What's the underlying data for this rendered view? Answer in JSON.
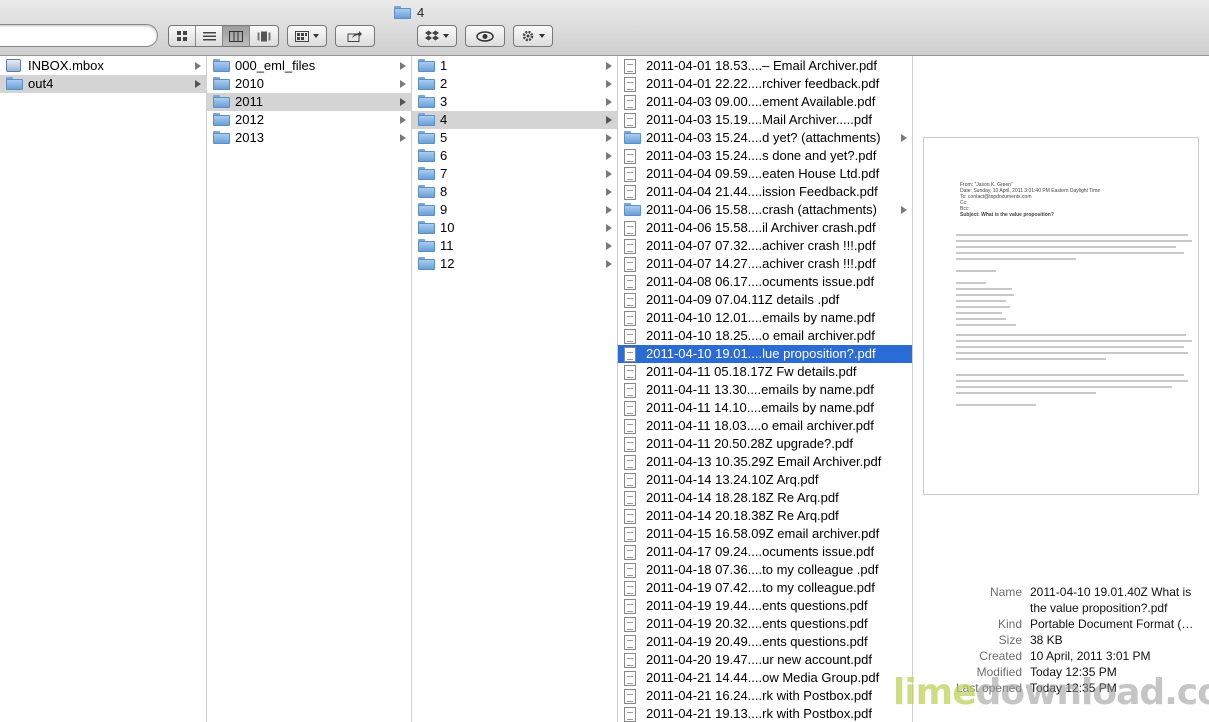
{
  "window": {
    "title": "4"
  },
  "toolbar": {
    "view_buttons": [
      "icon-view-icon",
      "list-view-icon",
      "column-view-icon",
      "coverflow-view-icon"
    ],
    "active_view": 2
  },
  "columns": {
    "col1": [
      {
        "label": "INBOX.mbox",
        "icon": "mbox",
        "arrow": true,
        "selected": false
      },
      {
        "label": "out4",
        "icon": "folder",
        "arrow": true,
        "selected": true
      }
    ],
    "col2": [
      {
        "label": "000_eml_files",
        "icon": "folder",
        "arrow": true,
        "selected": false
      },
      {
        "label": "2010",
        "icon": "folder",
        "arrow": true,
        "selected": false
      },
      {
        "label": "2011",
        "icon": "folder",
        "arrow": true,
        "selected": true
      },
      {
        "label": "2012",
        "icon": "folder",
        "arrow": true,
        "selected": false
      },
      {
        "label": "2013",
        "icon": "folder",
        "arrow": true,
        "selected": false
      }
    ],
    "col3": [
      {
        "label": "1",
        "icon": "folder",
        "arrow": true,
        "selected": false
      },
      {
        "label": "2",
        "icon": "folder",
        "arrow": true,
        "selected": false
      },
      {
        "label": "3",
        "icon": "folder",
        "arrow": true,
        "selected": false
      },
      {
        "label": "4",
        "icon": "folder",
        "arrow": true,
        "selected": true
      },
      {
        "label": "5",
        "icon": "folder",
        "arrow": true,
        "selected": false
      },
      {
        "label": "6",
        "icon": "folder",
        "arrow": true,
        "selected": false
      },
      {
        "label": "7",
        "icon": "folder",
        "arrow": true,
        "selected": false
      },
      {
        "label": "8",
        "icon": "folder",
        "arrow": true,
        "selected": false
      },
      {
        "label": "9",
        "icon": "folder",
        "arrow": true,
        "selected": false
      },
      {
        "label": "10",
        "icon": "folder",
        "arrow": true,
        "selected": false
      },
      {
        "label": "11",
        "icon": "folder",
        "arrow": true,
        "selected": false
      },
      {
        "label": "12",
        "icon": "folder",
        "arrow": true,
        "selected": false
      }
    ],
    "col4": [
      {
        "label": "2011-04-01 18.53....– Email Archiver.pdf",
        "icon": "pdf",
        "arrow": false,
        "selected": false
      },
      {
        "label": "2011-04-01 22.22....rchiver feedback.pdf",
        "icon": "pdf",
        "arrow": false,
        "selected": false
      },
      {
        "label": "2011-04-03 09.00....ement Available.pdf",
        "icon": "pdf",
        "arrow": false,
        "selected": false
      },
      {
        "label": "2011-04-03 15.19....Mail Archiver.....pdf",
        "icon": "pdf",
        "arrow": false,
        "selected": false
      },
      {
        "label": "2011-04-03 15.24....d yet? (attachments)",
        "icon": "folder",
        "arrow": true,
        "selected": false
      },
      {
        "label": "2011-04-03 15.24....s done and yet?.pdf",
        "icon": "pdf",
        "arrow": false,
        "selected": false
      },
      {
        "label": "2011-04-04 09.59....eaten House Ltd.pdf",
        "icon": "pdf",
        "arrow": false,
        "selected": false
      },
      {
        "label": "2011-04-04 21.44....ission Feedback.pdf",
        "icon": "pdf",
        "arrow": false,
        "selected": false
      },
      {
        "label": "2011-04-06 15.58....crash (attachments)",
        "icon": "folder",
        "arrow": true,
        "selected": false
      },
      {
        "label": "2011-04-06 15.58....il Archiver crash.pdf",
        "icon": "pdf",
        "arrow": false,
        "selected": false
      },
      {
        "label": "2011-04-07 07.32....achiver crash !!!.pdf",
        "icon": "pdf",
        "arrow": false,
        "selected": false
      },
      {
        "label": "2011-04-07 14.27....achiver crash !!!.pdf",
        "icon": "pdf",
        "arrow": false,
        "selected": false
      },
      {
        "label": "2011-04-08 06.17....ocuments issue.pdf",
        "icon": "pdf",
        "arrow": false,
        "selected": false
      },
      {
        "label": "2011-04-09 07.04.11Z  details .pdf",
        "icon": "pdf",
        "arrow": false,
        "selected": false
      },
      {
        "label": "2011-04-10 12.01....emails by name.pdf",
        "icon": "pdf",
        "arrow": false,
        "selected": false
      },
      {
        "label": "2011-04-10 18.25....o email archiver.pdf",
        "icon": "pdf",
        "arrow": false,
        "selected": false
      },
      {
        "label": "2011-04-10 19.01....lue proposition?.pdf",
        "icon": "pdf",
        "arrow": false,
        "selected": true
      },
      {
        "label": "2011-04-11 05.18.17Z  Fw  details.pdf",
        "icon": "pdf",
        "arrow": false,
        "selected": false
      },
      {
        "label": "2011-04-11 13.30....emails by name.pdf",
        "icon": "pdf",
        "arrow": false,
        "selected": false
      },
      {
        "label": "2011-04-11 14.10....emails by name.pdf",
        "icon": "pdf",
        "arrow": false,
        "selected": false
      },
      {
        "label": "2011-04-11 18.03....o email archiver.pdf",
        "icon": "pdf",
        "arrow": false,
        "selected": false
      },
      {
        "label": "2011-04-11 20.50.28Z  upgrade?.pdf",
        "icon": "pdf",
        "arrow": false,
        "selected": false
      },
      {
        "label": "2011-04-13 10.35.29Z  Email Archiver.pdf",
        "icon": "pdf",
        "arrow": false,
        "selected": false
      },
      {
        "label": "2011-04-14 13.24.10Z  Arq.pdf",
        "icon": "pdf",
        "arrow": false,
        "selected": false
      },
      {
        "label": "2011-04-14 18.28.18Z  Re  Arq.pdf",
        "icon": "pdf",
        "arrow": false,
        "selected": false
      },
      {
        "label": "2011-04-14 20.18.38Z  Re  Arq.pdf",
        "icon": "pdf",
        "arrow": false,
        "selected": false
      },
      {
        "label": "2011-04-15 16.58.09Z  email archiver.pdf",
        "icon": "pdf",
        "arrow": false,
        "selected": false
      },
      {
        "label": "2011-04-17 09.24....ocuments issue.pdf",
        "icon": "pdf",
        "arrow": false,
        "selected": false
      },
      {
        "label": "2011-04-18 07.36....to my colleague .pdf",
        "icon": "pdf",
        "arrow": false,
        "selected": false
      },
      {
        "label": "2011-04-19 07.42....to my colleague.pdf",
        "icon": "pdf",
        "arrow": false,
        "selected": false
      },
      {
        "label": "2011-04-19 19.44....ents questions.pdf",
        "icon": "pdf",
        "arrow": false,
        "selected": false
      },
      {
        "label": "2011-04-19 20.32....ents questions.pdf",
        "icon": "pdf",
        "arrow": false,
        "selected": false
      },
      {
        "label": "2011-04-19 20.49....ents questions.pdf",
        "icon": "pdf",
        "arrow": false,
        "selected": false
      },
      {
        "label": "2011-04-20 19.47....ur new account.pdf",
        "icon": "pdf",
        "arrow": false,
        "selected": false
      },
      {
        "label": "2011-04-21 14.44....ow Media Group.pdf",
        "icon": "pdf",
        "arrow": false,
        "selected": false
      },
      {
        "label": "2011-04-21 16.24....rk with Postbox.pdf",
        "icon": "pdf",
        "arrow": false,
        "selected": false
      },
      {
        "label": "2011-04-21 19.13....rk with Postbox.pdf",
        "icon": "pdf",
        "arrow": false,
        "selected": false
      }
    ]
  },
  "preview": {
    "doc_header_lines": [
      "From:  \"Jason K. Green\"",
      "Date:  Sunday, 10 April, 2011 3:01:40 PM Eastern Daylight Time",
      "To:  contact@topdocuments.com",
      "Cc:",
      "Bcc:",
      "Subject:  What is the value proposition?"
    ],
    "info": [
      {
        "key": "Name",
        "value": "2011-04-10 19.01.40Z  What is the value proposition?.pdf"
      },
      {
        "key": "Kind",
        "value": "Portable Document Format (…"
      },
      {
        "key": "Size",
        "value": "38 KB"
      },
      {
        "key": "Created",
        "value": "10 April, 2011 3:01 PM"
      },
      {
        "key": "Modified",
        "value": "Today 12:35 PM"
      },
      {
        "key": "Last opened",
        "value": "Today 12:35 PM"
      }
    ]
  },
  "watermark": {
    "part1": "lime",
    "part2": "download.com"
  }
}
